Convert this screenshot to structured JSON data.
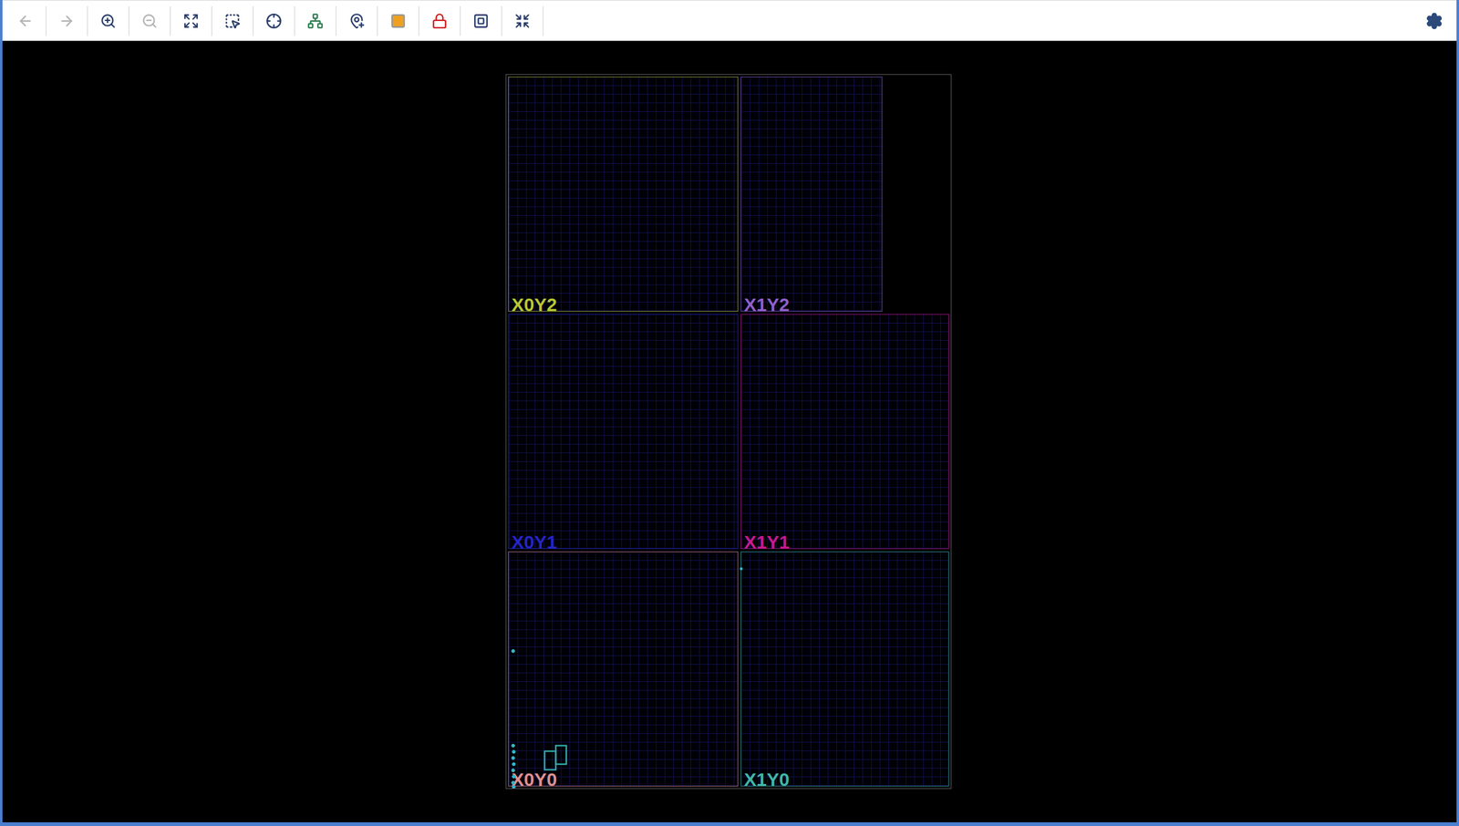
{
  "toolbar": {
    "buttons": [
      {
        "kind": "back",
        "disabled": true
      },
      {
        "kind": "forward",
        "disabled": true
      },
      {
        "kind": "zoom-in",
        "disabled": false
      },
      {
        "kind": "zoom-out",
        "disabled": true
      },
      {
        "kind": "fit",
        "disabled": false
      },
      {
        "kind": "zoom-area",
        "disabled": false
      },
      {
        "kind": "crosshair",
        "disabled": false
      },
      {
        "kind": "routing",
        "disabled": false
      },
      {
        "kind": "add-pblock",
        "disabled": false
      },
      {
        "kind": "highlight",
        "disabled": false
      },
      {
        "kind": "lock",
        "disabled": false
      },
      {
        "kind": "frame",
        "disabled": false
      },
      {
        "kind": "autofit",
        "disabled": false
      }
    ],
    "settings": {
      "kind": "settings"
    }
  },
  "device": {
    "clock_regions": [
      {
        "label": "X0Y2",
        "color": "#b8c832"
      },
      {
        "label": "X1Y2",
        "color": "#9060c8"
      },
      {
        "label": "X0Y1",
        "color": "#2424c8"
      },
      {
        "label": "X1Y1",
        "color": "#c81890"
      },
      {
        "label": "X0Y0",
        "color": "#e09090"
      },
      {
        "label": "X1Y0",
        "color": "#40b8a8"
      }
    ]
  }
}
